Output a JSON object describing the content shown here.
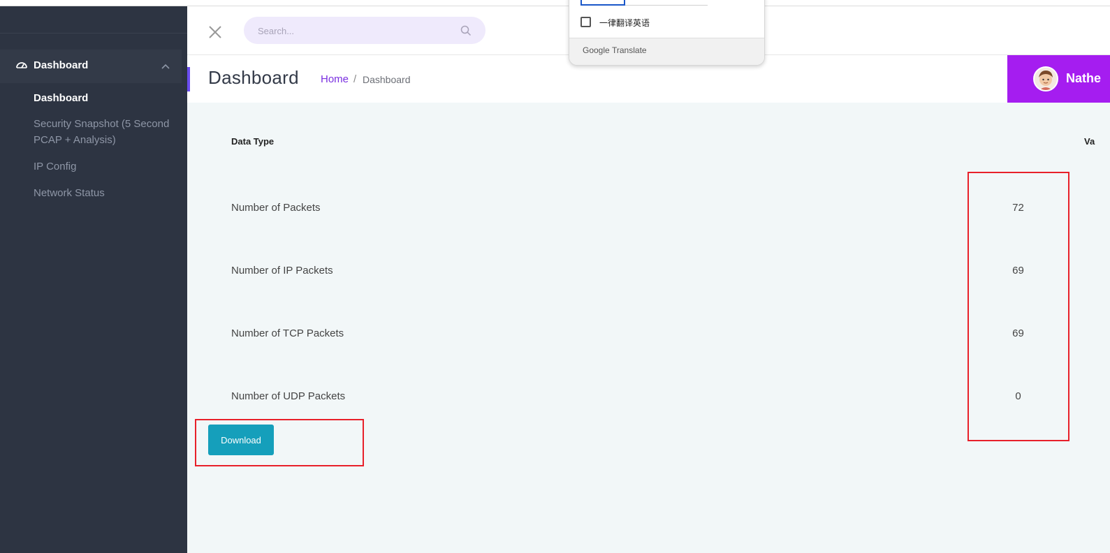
{
  "sidebar": {
    "section_label": "Dashboard",
    "items": [
      {
        "label": "Dashboard",
        "active": true
      },
      {
        "label": "Security Snapshot (5 Second PCAP + Analysis)",
        "active": false
      },
      {
        "label": "IP Config",
        "active": false
      },
      {
        "label": "Network Status",
        "active": false
      }
    ]
  },
  "header": {
    "search_placeholder": "Search..."
  },
  "page": {
    "title": "Dashboard",
    "breadcrumb_home": "Home",
    "breadcrumb_sep": "/",
    "breadcrumb_current": "Dashboard",
    "user_name": "Nathe"
  },
  "table": {
    "col_type": "Data Type",
    "col_value": "Va",
    "rows": [
      {
        "label": "Number of Packets",
        "value": "72"
      },
      {
        "label": "Number of IP Packets",
        "value": "69"
      },
      {
        "label": "Number of TCP Packets",
        "value": "69"
      },
      {
        "label": "Number of UDP Packets",
        "value": "0"
      }
    ]
  },
  "download_label": "Download",
  "translate_popup": {
    "checkbox_label": "一律翻译英语",
    "brand_google": "Google",
    "brand_translate": "Translate"
  },
  "colors": {
    "sidebar_bg": "#2d3442",
    "accent_purple": "#a51df0",
    "breadcrumb_link": "#7a2fe0",
    "button_teal": "#159fbb",
    "highlight_red": "#e8202a"
  },
  "icons": {
    "menu": "dashboard-gauge-icon",
    "collapse": "chevron-up-icon",
    "close": "close-icon",
    "search": "search-icon"
  }
}
